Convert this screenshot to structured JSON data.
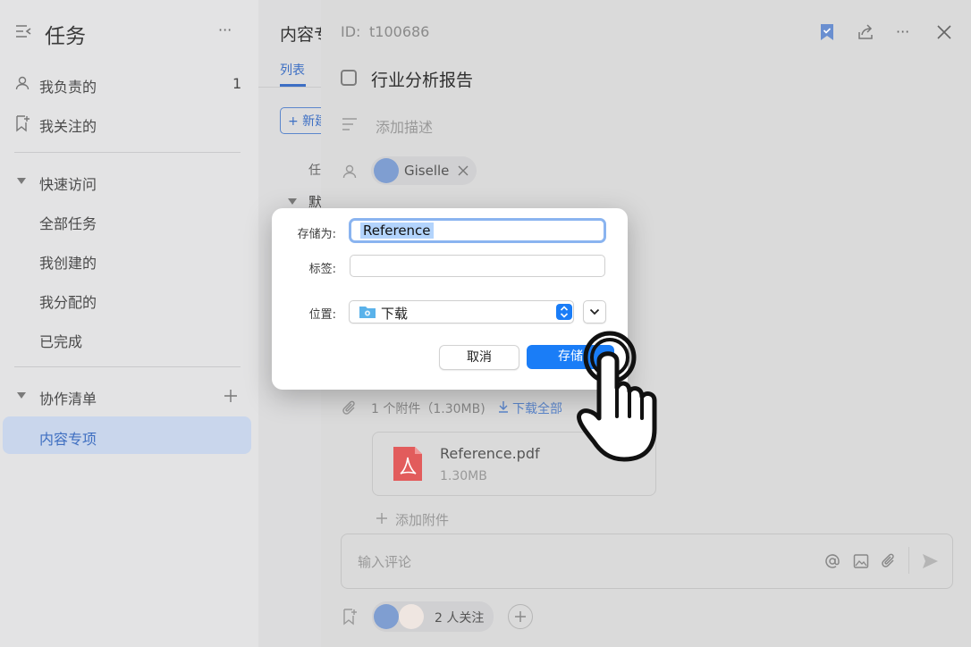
{
  "sidebar": {
    "title": "任务",
    "more": "···",
    "items": [
      {
        "label": "我负责的",
        "count": "1"
      },
      {
        "label": "我关注的"
      }
    ],
    "quick_access": {
      "label": "快速访问",
      "items": [
        "全部任务",
        "我创建的",
        "我分配的",
        "已完成"
      ]
    },
    "collab": {
      "label": "协作清单",
      "items": [
        "内容专项"
      ]
    }
  },
  "middle": {
    "title": "内容专",
    "tab": "列表",
    "new_btn": "+ 新建",
    "col_header": "任",
    "group": "默"
  },
  "detail": {
    "id_label": "ID:",
    "id_value": "t100686",
    "task_title": "行业分析报告",
    "desc_placeholder": "添加描述",
    "assignee": "Giselle",
    "attachments_summary": "1 个附件（1.30MB)",
    "download_all": "下载全部",
    "file_name": "Reference.pdf",
    "file_size": "1.30MB",
    "add_attachment": "添加附件",
    "comment_placeholder": "输入评论",
    "followers": "2 人关注"
  },
  "dialog": {
    "save_as_label": "存储为:",
    "save_as_value": "Reference",
    "tags_label": "标签:",
    "tags_value": "",
    "location_label": "位置:",
    "location_value": "下载",
    "cancel": "取消",
    "save": "存储"
  },
  "colors": {
    "accent": "#1a7df7",
    "pdf_red": "#e25c5c",
    "active_bg": "#c9d6ec"
  }
}
